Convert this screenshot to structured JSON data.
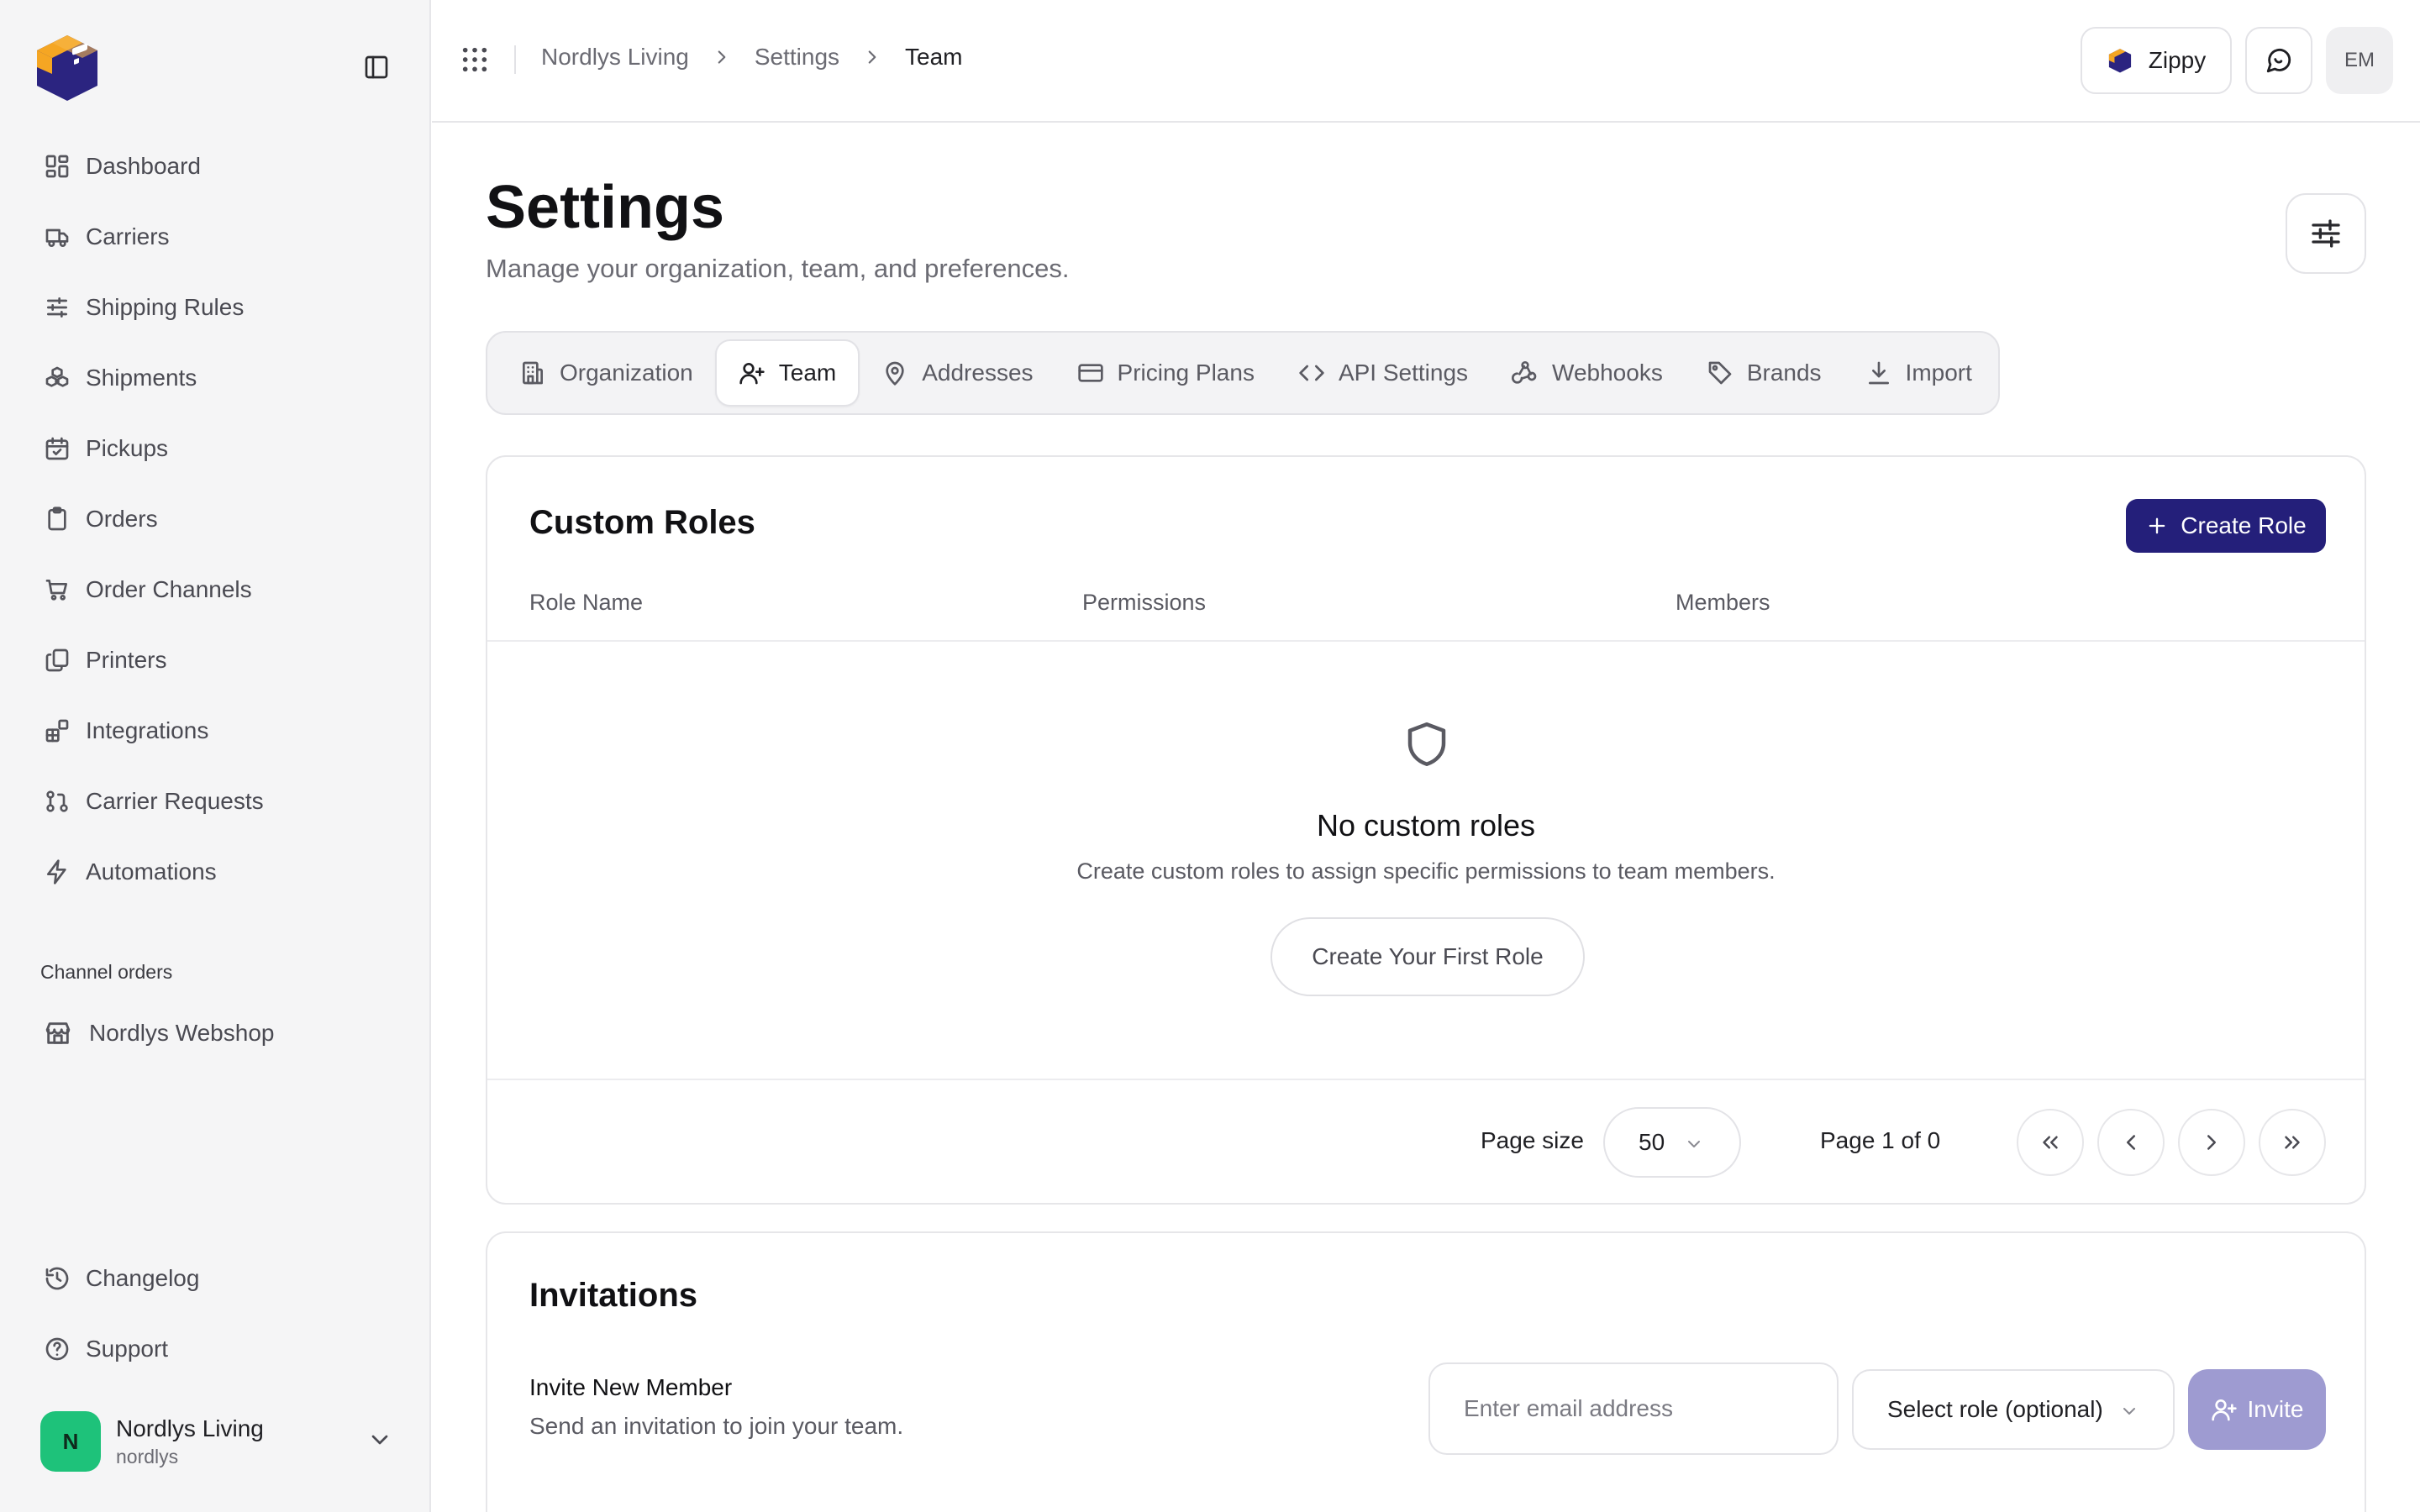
{
  "sidebar": {
    "nav": [
      {
        "label": "Dashboard",
        "icon": "dashboard-icon"
      },
      {
        "label": "Carriers",
        "icon": "truck-icon"
      },
      {
        "label": "Shipping Rules",
        "icon": "sliders-icon"
      },
      {
        "label": "Shipments",
        "icon": "boxes-icon"
      },
      {
        "label": "Pickups",
        "icon": "calendar-check-icon"
      },
      {
        "label": "Orders",
        "icon": "clipboard-icon"
      },
      {
        "label": "Order Channels",
        "icon": "cart-icon"
      },
      {
        "label": "Printers",
        "icon": "copy-icon"
      },
      {
        "label": "Integrations",
        "icon": "blocks-icon"
      },
      {
        "label": "Carrier Requests",
        "icon": "git-pull-request-icon"
      },
      {
        "label": "Automations",
        "icon": "zap-icon"
      }
    ],
    "section_title": "Channel orders",
    "channel_item": "Nordlys Webshop",
    "bottom": [
      {
        "label": "Changelog",
        "icon": "history-icon"
      },
      {
        "label": "Support",
        "icon": "help-circle-icon"
      }
    ],
    "user": {
      "initial": "N",
      "name": "Nordlys Living",
      "handle": "nordlys",
      "avatar_color": "#1ec27a"
    }
  },
  "topbar": {
    "breadcrumb": [
      "Nordlys Living",
      "Settings",
      "Team"
    ],
    "brand_button": "Zippy",
    "user_initials": "EM"
  },
  "page": {
    "title": "Settings",
    "subtitle": "Manage your organization, team, and preferences."
  },
  "tabs": [
    {
      "label": "Organization",
      "icon": "building-icon",
      "active": false
    },
    {
      "label": "Team",
      "icon": "user-plus-icon",
      "active": true
    },
    {
      "label": "Addresses",
      "icon": "map-pin-icon",
      "active": false
    },
    {
      "label": "Pricing Plans",
      "icon": "credit-card-icon",
      "active": false
    },
    {
      "label": "API Settings",
      "icon": "code-icon",
      "active": false
    },
    {
      "label": "Webhooks",
      "icon": "webhook-icon",
      "active": false
    },
    {
      "label": "Brands",
      "icon": "tag-icon",
      "active": false
    },
    {
      "label": "Import",
      "icon": "download-icon",
      "active": false
    }
  ],
  "custom_roles": {
    "title": "Custom Roles",
    "create_button": "Create Role",
    "columns": [
      "Role Name",
      "Permissions",
      "Members"
    ],
    "empty_title": "No custom roles",
    "empty_desc": "Create custom roles to assign specific permissions to team members.",
    "empty_button": "Create Your First Role",
    "pagination": {
      "page_size_label": "Page size",
      "page_size": "50",
      "page_info": "Page 1 of 0"
    }
  },
  "invitations": {
    "title": "Invitations",
    "invite_heading": "Invite New Member",
    "invite_desc": "Send an invitation to join your team.",
    "email_placeholder": "Enter email address",
    "role_select": "Select role (optional)",
    "invite_button": "Invite"
  },
  "colors": {
    "accent": "#241f7a",
    "invite_disabled": "#9e9bd1",
    "avatar": "#1ec27a",
    "logo_orange": "#f5a623"
  }
}
